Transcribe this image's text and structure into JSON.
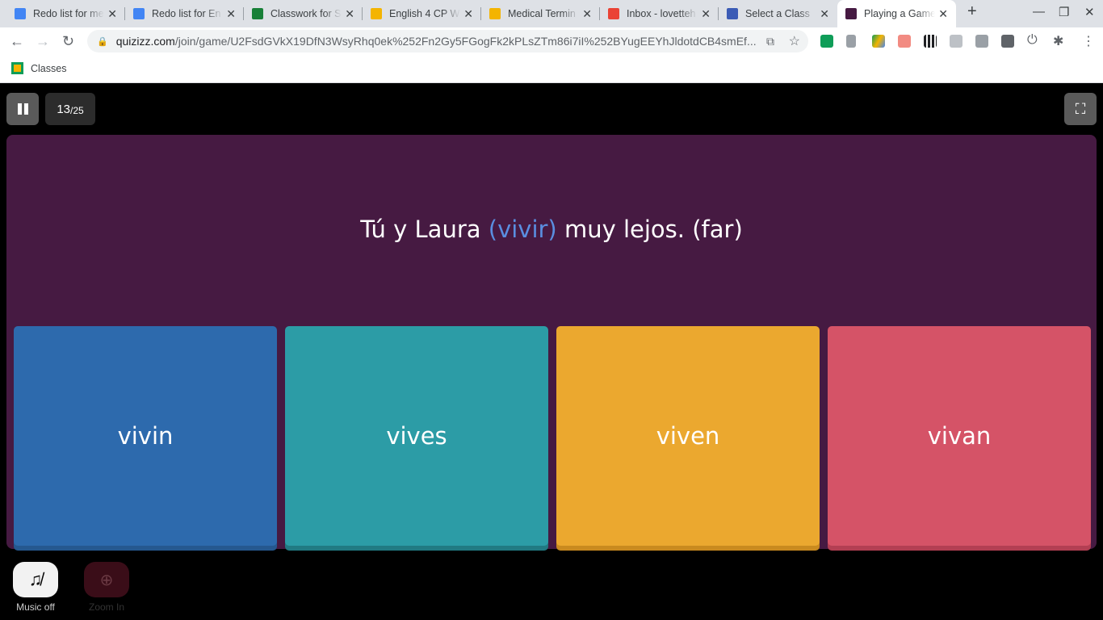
{
  "browser": {
    "tabs": [
      {
        "title": "Redo list for me",
        "icon": "docs-icon",
        "color": "#4285f4"
      },
      {
        "title": "Redo list for En",
        "icon": "docs-icon",
        "color": "#4285f4"
      },
      {
        "title": "Classwork for S",
        "icon": "classroom-icon",
        "color": "#188038"
      },
      {
        "title": "English 4 CP W",
        "icon": "slides-icon",
        "color": "#f4b400"
      },
      {
        "title": "Medical Termin",
        "icon": "slides-icon",
        "color": "#f4b400"
      },
      {
        "title": "Inbox - lovetteh",
        "icon": "gmail-icon",
        "color": "#ea4335"
      },
      {
        "title": "Select a Class",
        "icon": "app-icon",
        "color": "#3b5bb5"
      },
      {
        "title": "Playing a Game",
        "icon": "quizizz-icon",
        "color": "#461a42"
      }
    ],
    "url_domain": "quizizz.com",
    "url_path": "/join/game/U2FsdGVkX19DfN3WsyRhq0ek%252Fn2Gy5FGogFk2kPLsZTm86i7iI%252BYugEEYhJldotdCB4smEf...",
    "bookmark": "Classes"
  },
  "game": {
    "progress_current": "13",
    "progress_total": "/25",
    "question_before": "Tú y Laura ",
    "question_highlight": "(vivir)",
    "question_after": " muy lejos. (far)",
    "options": [
      {
        "text": "vivin",
        "color": "#2d6aad",
        "shade": "#25588f"
      },
      {
        "text": "vives",
        "color": "#2c9ca6",
        "shade": "#217a82"
      },
      {
        "text": "viven",
        "color": "#eba82f",
        "shade": "#c98a1f"
      },
      {
        "text": "vivan",
        "color": "#d55367",
        "shade": "#b33f53"
      }
    ],
    "music_label": "Music off",
    "zoom_label": "Zoom In"
  }
}
